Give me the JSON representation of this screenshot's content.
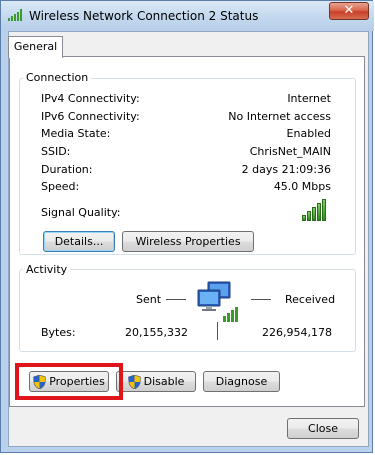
{
  "window": {
    "title": "Wireless Network Connection 2 Status",
    "close_symbol": "✕"
  },
  "tabs": [
    {
      "label": "General"
    }
  ],
  "connection": {
    "group_label": "Connection",
    "rows": [
      {
        "label": "IPv4 Connectivity:",
        "value": "Internet"
      },
      {
        "label": "IPv6 Connectivity:",
        "value": "No Internet access"
      },
      {
        "label": "Media State:",
        "value": "Enabled"
      },
      {
        "label": "SSID:",
        "value": "ChrisNet_MAIN"
      },
      {
        "label": "Duration:",
        "value": "2 days 21:09:36"
      },
      {
        "label": "Speed:",
        "value": "45.0 Mbps"
      }
    ],
    "signal_label": "Signal Quality:",
    "signal_bars_lit": 5,
    "signal_bars_total": 5,
    "details_button": "Details...",
    "wireless_properties_button": "Wireless Properties"
  },
  "activity": {
    "group_label": "Activity",
    "sent_label": "Sent",
    "received_label": "Received",
    "bytes_label": "Bytes:",
    "bytes_sent": "20,155,332",
    "bytes_received": "226,954,178"
  },
  "buttons": {
    "properties": "Properties",
    "disable": "Disable",
    "diagnose": "Diagnose",
    "close": "Close"
  },
  "colors": {
    "highlight": "#e0151b",
    "signal_green": "#2e8b1f"
  }
}
